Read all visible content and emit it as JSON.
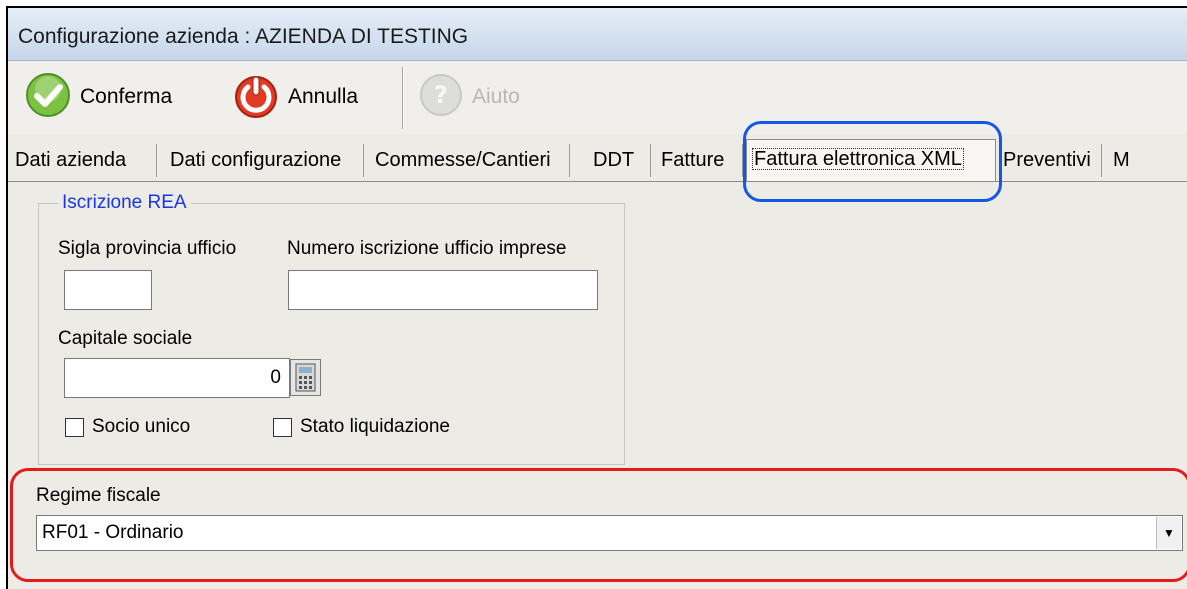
{
  "window": {
    "title": "Configurazione azienda : AZIENDA DI TESTING"
  },
  "toolbar": {
    "confirm_label": "Conferma",
    "cancel_label": "Annulla",
    "help_label": "Aiuto",
    "icons": {
      "confirm": "check-icon",
      "cancel": "power-icon",
      "help": "question-icon"
    }
  },
  "tabs": [
    {
      "label": "Dati azienda"
    },
    {
      "label": "Dati configurazione"
    },
    {
      "label": "Commesse/Cantieri"
    },
    {
      "label": "DDT"
    },
    {
      "label": "Fatture"
    },
    {
      "label": "Fattura elettronica XML",
      "active": true
    },
    {
      "label": "Preventivi"
    },
    {
      "label": "M"
    }
  ],
  "rea": {
    "group_title": "Iscrizione REA",
    "province_label": "Sigla provincia ufficio",
    "province_value": "",
    "register_number_label": "Numero iscrizione ufficio imprese",
    "register_number_value": "",
    "share_capital_label": "Capitale sociale",
    "share_capital_value": "0",
    "sole_partner_label": "Socio unico",
    "liquidation_label": "Stato liquidazione"
  },
  "tax": {
    "regime_label": "Regime fiscale",
    "regime_value": "RF01 - Ordinario"
  },
  "colors": {
    "highlight_blue": "#1457e6",
    "highlight_red": "#e31b1b",
    "group_title": "#1b35e6"
  }
}
